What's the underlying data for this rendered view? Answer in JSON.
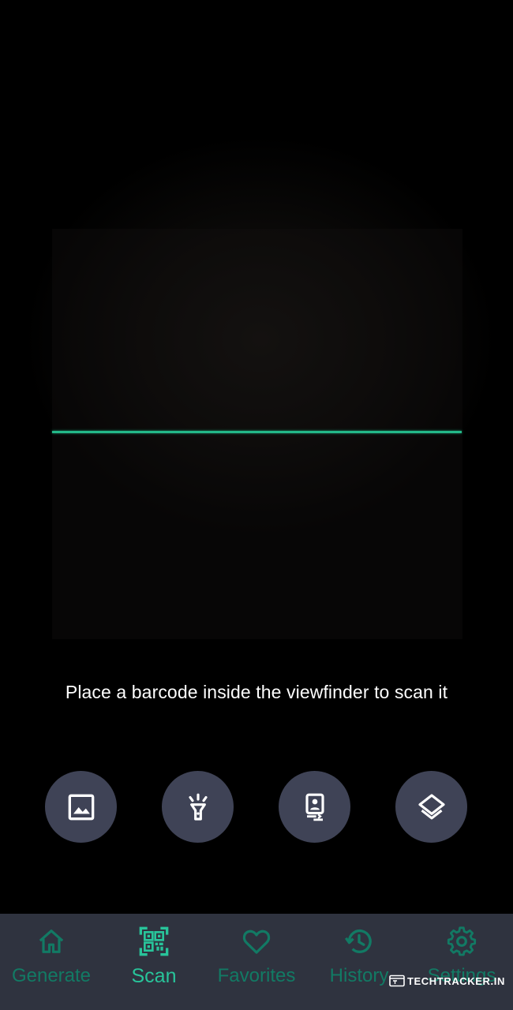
{
  "scanner": {
    "hint": "Place a barcode inside the viewfinder to scan it"
  },
  "actions": [
    {
      "name": "gallery",
      "icon": "image-icon"
    },
    {
      "name": "flashlight",
      "icon": "flashlight-icon"
    },
    {
      "name": "front-camera",
      "icon": "camera-switch-icon"
    },
    {
      "name": "batch-scan",
      "icon": "layers-icon"
    }
  ],
  "bottom_nav": {
    "items": [
      {
        "label": "Generate",
        "icon": "home-icon",
        "active": false
      },
      {
        "label": "Scan",
        "icon": "qr-scan-icon",
        "active": true
      },
      {
        "label": "Favorites",
        "icon": "heart-icon",
        "active": false
      },
      {
        "label": "History",
        "icon": "history-icon",
        "active": false
      },
      {
        "label": "Settings",
        "icon": "gear-icon",
        "active": false
      }
    ]
  },
  "watermark": {
    "text": "TECHTRACKER.IN"
  },
  "colors": {
    "accent": "#28c49a",
    "accent_dim": "#127a64",
    "scan_line": "#23b889",
    "action_button_bg": "#3f4356",
    "nav_bg": "#2f333f"
  }
}
